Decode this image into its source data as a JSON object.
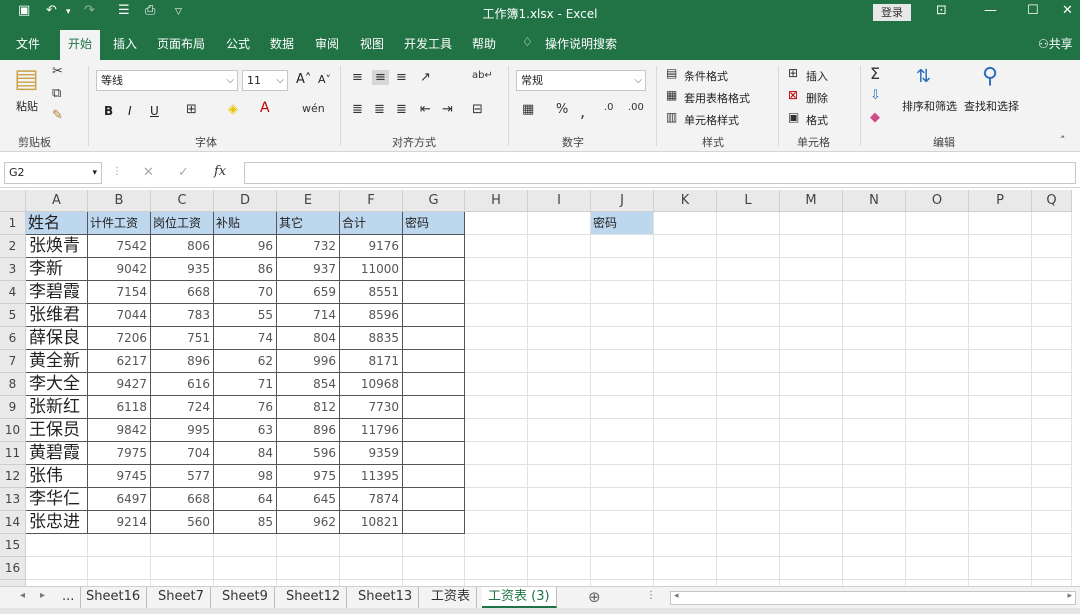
{
  "titlebar": {
    "title": "工作簿1.xlsx  -  Excel",
    "login": "登录",
    "save_icon": "save-icon",
    "undo_icon": "undo-icon",
    "redo_icon": "redo-icon",
    "brand_color": "#217346"
  },
  "ribbon_tabs": [
    "文件",
    "开始",
    "插入",
    "页面布局",
    "公式",
    "数据",
    "审阅",
    "视图",
    "开发工具",
    "帮助",
    "操作说明搜索"
  ],
  "share": "共享",
  "ribbon": {
    "paste": "粘贴",
    "clipboard": "剪贴板",
    "font_name": "等线",
    "font_size": "11",
    "bold": "B",
    "italic": "I",
    "underline": "U",
    "font_group": "字体",
    "align_group": "对齐方式",
    "number_format": "常规",
    "number_group": "数字",
    "cond_format": "条件格式",
    "table_format": "套用表格格式",
    "cell_style": "单元格样式",
    "style_group": "样式",
    "insert": "插入",
    "delete": "删除",
    "format": "格式",
    "cells_group": "单元格",
    "sort_filter": "排序和筛选",
    "find_select": "查找和选择",
    "edit_group": "编辑"
  },
  "formula_bar": {
    "name_box": "G2",
    "fx": "fx",
    "formula": ""
  },
  "columns": [
    "A",
    "B",
    "C",
    "D",
    "E",
    "F",
    "G",
    "H",
    "I",
    "J",
    "K",
    "L",
    "M",
    "N",
    "O",
    "P",
    "Q"
  ],
  "rows": [
    "1",
    "2",
    "3",
    "4",
    "5",
    "6",
    "7",
    "8",
    "9",
    "10",
    "11",
    "12",
    "13",
    "14",
    "15",
    "16",
    "17"
  ],
  "headers": [
    "姓名",
    "计件工资",
    "岗位工资",
    "补贴",
    "其它",
    "合计",
    "密码"
  ],
  "j1": "密码",
  "table": [
    [
      "张焕青",
      "7542",
      "806",
      "96",
      "732",
      "9176"
    ],
    [
      "李新",
      "9042",
      "935",
      "86",
      "937",
      "11000"
    ],
    [
      "李碧霞",
      "7154",
      "668",
      "70",
      "659",
      "8551"
    ],
    [
      "张维君",
      "7044",
      "783",
      "55",
      "714",
      "8596"
    ],
    [
      "薛保良",
      "7206",
      "751",
      "74",
      "804",
      "8835"
    ],
    [
      "黄全新",
      "6217",
      "896",
      "62",
      "996",
      "8171"
    ],
    [
      "李大全",
      "9427",
      "616",
      "71",
      "854",
      "10968"
    ],
    [
      "张新红",
      "6118",
      "724",
      "76",
      "812",
      "7730"
    ],
    [
      "王保员",
      "9842",
      "995",
      "63",
      "896",
      "11796"
    ],
    [
      "黄碧霞",
      "7975",
      "704",
      "84",
      "596",
      "9359"
    ],
    [
      "张伟",
      "9745",
      "577",
      "98",
      "975",
      "11395"
    ],
    [
      "李华仁",
      "6497",
      "668",
      "64",
      "645",
      "7874"
    ],
    [
      "张忠进",
      "9214",
      "560",
      "85",
      "962",
      "10821"
    ]
  ],
  "sheets": [
    "...",
    "Sheet16",
    "Sheet7",
    "Sheet9",
    "Sheet12",
    "Sheet13",
    "工资表",
    "工资表 (3)"
  ],
  "active_sheet": "工资表 (3)"
}
